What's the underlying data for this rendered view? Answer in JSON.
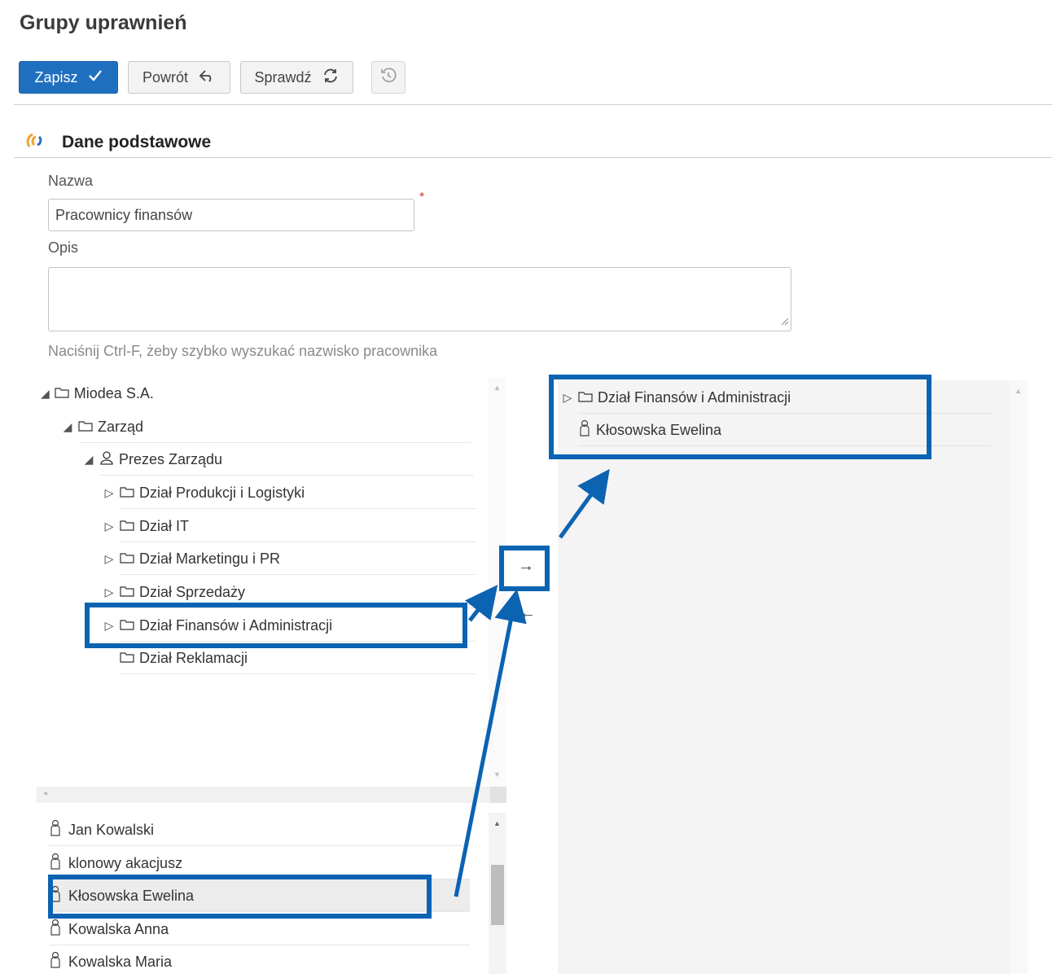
{
  "page": {
    "title": "Grupy uprawnień"
  },
  "toolbar": {
    "save_label": "Zapisz",
    "save_icon": "check-icon",
    "back_label": "Powrót",
    "back_icon": "reply-icon",
    "check_label": "Sprawdź",
    "check_icon": "refresh-icon",
    "history_icon": "history-icon"
  },
  "section": {
    "title": "Dane podstawowe",
    "icon": "dots-spinner-icon"
  },
  "form": {
    "name_label": "Nazwa",
    "name_value": "Pracownicy finansów",
    "required_mark": "*",
    "desc_label": "Opis",
    "desc_value": "",
    "hint": "Naciśnij Ctrl-F, żeby szybko wyszukać nazwisko pracownika"
  },
  "tree": {
    "items": [
      {
        "label": "Miodea S.A.",
        "icon": "folder-icon",
        "toggle": "expanded"
      },
      {
        "label": "Zarząd",
        "icon": "folder-icon",
        "toggle": "expanded"
      },
      {
        "label": "Prezes Zarządu",
        "icon": "person-icon",
        "toggle": "expanded"
      },
      {
        "label": "Dział Produkcji i Logistyki",
        "icon": "folder-icon",
        "toggle": "collapsed"
      },
      {
        "label": "Dział IT",
        "icon": "folder-icon",
        "toggle": "collapsed"
      },
      {
        "label": "Dział Marketingu i PR",
        "icon": "folder-icon",
        "toggle": "collapsed"
      },
      {
        "label": "Dział Sprzedaży",
        "icon": "folder-icon",
        "toggle": "collapsed"
      },
      {
        "label": "Dział Finansów i Administracji",
        "icon": "folder-icon",
        "toggle": "collapsed"
      },
      {
        "label": "Dział Reklamacji",
        "icon": "folder-icon",
        "toggle": "none"
      }
    ]
  },
  "employees": {
    "items": [
      {
        "label": "Jan Kowalski"
      },
      {
        "label": "klonowy akacjusz"
      },
      {
        "label": "Kłosowska Ewelina",
        "selected": true
      },
      {
        "label": "Kowalska Anna"
      },
      {
        "label": "Kowalska Maria"
      }
    ]
  },
  "transfer": {
    "add_symbol": "→",
    "remove_symbol": "←"
  },
  "selected": {
    "items": [
      {
        "label": "Dział Finansów i Administracji",
        "icon": "folder-icon"
      },
      {
        "label": "Kłosowska Ewelina",
        "icon": "person-icon"
      }
    ]
  },
  "colors": {
    "accent": "#1f6fbf",
    "highlight": "#0b63b2",
    "required": "#d9362b"
  }
}
